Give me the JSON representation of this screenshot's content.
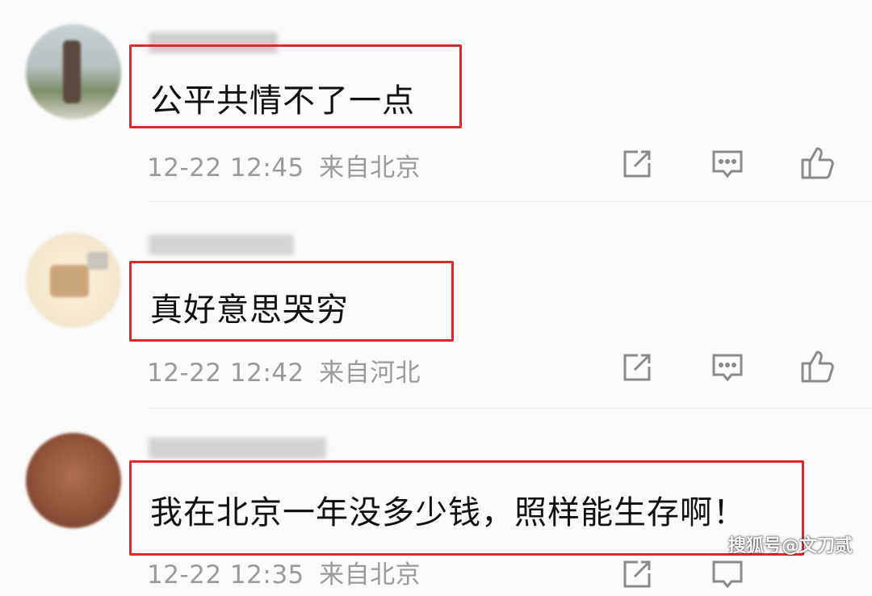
{
  "comments": [
    {
      "text": "公平共情不了一点",
      "time": "12-22 12:45",
      "location": "来自北京"
    },
    {
      "text": "真好意思哭穷",
      "time": "12-22 12:42",
      "location": "来自河北"
    },
    {
      "text": "我在北京一年没多少钱，照样能生存啊！",
      "time": "12-22 12:35",
      "location": "来自北京"
    }
  ],
  "actions": {
    "share_icon": "share-icon",
    "reply_icon": "comment-icon",
    "like_icon": "thumbs-up-icon"
  },
  "watermark": "搜狐号@文刀贰",
  "colors": {
    "highlight_box": "#d92b2b",
    "meta_text": "#9a9a9a"
  }
}
